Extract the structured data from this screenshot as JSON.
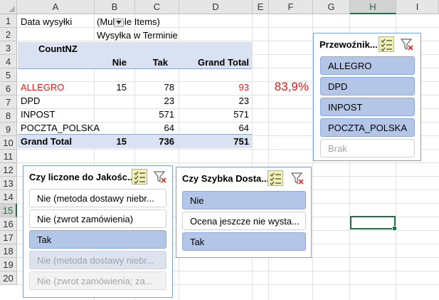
{
  "columns": [
    "A",
    "B",
    "C",
    "D",
    "E",
    "F",
    "G",
    "H",
    "I"
  ],
  "rows": [
    "1",
    "2",
    "3",
    "4",
    "5",
    "6",
    "7",
    "8",
    "9",
    "10",
    "11",
    "12",
    "13",
    "14",
    "15",
    "16",
    "17",
    "18",
    "19",
    "20"
  ],
  "selected_column": "H",
  "selected_row": "15",
  "pivot": {
    "filter_label": "Data wysyłki",
    "filter_value": "(Multiple Items)",
    "column_field": "Wysyłka w Terminie",
    "value_label": "CountNZ",
    "col_headers": [
      "Nie",
      "Tak",
      "Grand Total"
    ],
    "rows": [
      {
        "label": "ALLEGRO",
        "nie": "15",
        "tak": "78",
        "total": "93"
      },
      {
        "label": "DPD",
        "nie": "",
        "tak": "23",
        "total": "23"
      },
      {
        "label": "INPOST",
        "nie": "",
        "tak": "571",
        "total": "571"
      },
      {
        "label": "POCZTA_POLSKA",
        "nie": "",
        "tak": "64",
        "total": "64"
      }
    ],
    "grand_total": {
      "label": "Grand Total",
      "nie": "15",
      "tak": "736",
      "total": "751"
    },
    "percent": "83,9%"
  },
  "slicers": {
    "przewoznik": {
      "title": "Przewoźnik...",
      "items": [
        {
          "label": "ALLEGRO",
          "state": "on"
        },
        {
          "label": "DPD",
          "state": "on"
        },
        {
          "label": "INPOST",
          "state": "on"
        },
        {
          "label": "POCZTA_POLSKA",
          "state": "on"
        },
        {
          "label": "Brak",
          "state": "nodata"
        }
      ]
    },
    "jakosc": {
      "title": "Czy liczone do Jakośc...",
      "items": [
        {
          "label": "Nie (metoda dostawy niebr...",
          "state": "off"
        },
        {
          "label": "Nie (zwrot zamówienia)",
          "state": "off"
        },
        {
          "label": "Tak",
          "state": "on"
        },
        {
          "label": "Nie (metoda dostawy niebr...",
          "state": "nodata"
        },
        {
          "label": "Nie (zwrot zamówienia; za...",
          "state": "nodata"
        }
      ]
    },
    "szybka": {
      "title": "Czy Szybka Dosta...",
      "items": [
        {
          "label": "Nie",
          "state": "on"
        },
        {
          "label": "Ocena jeszcze nie wysta...",
          "state": "off"
        },
        {
          "label": "Tak",
          "state": "on"
        }
      ]
    }
  },
  "colors": {
    "accent": "#217346",
    "pivot_band": "#d9e1f2",
    "slicer_selected": "#b4c6e7",
    "red": "#e01b1b"
  },
  "icons": {
    "multi_select": "multi-select-icon",
    "clear_filter": "clear-filter-icon",
    "dropdown_filter": "filter-dropdown-icon"
  }
}
